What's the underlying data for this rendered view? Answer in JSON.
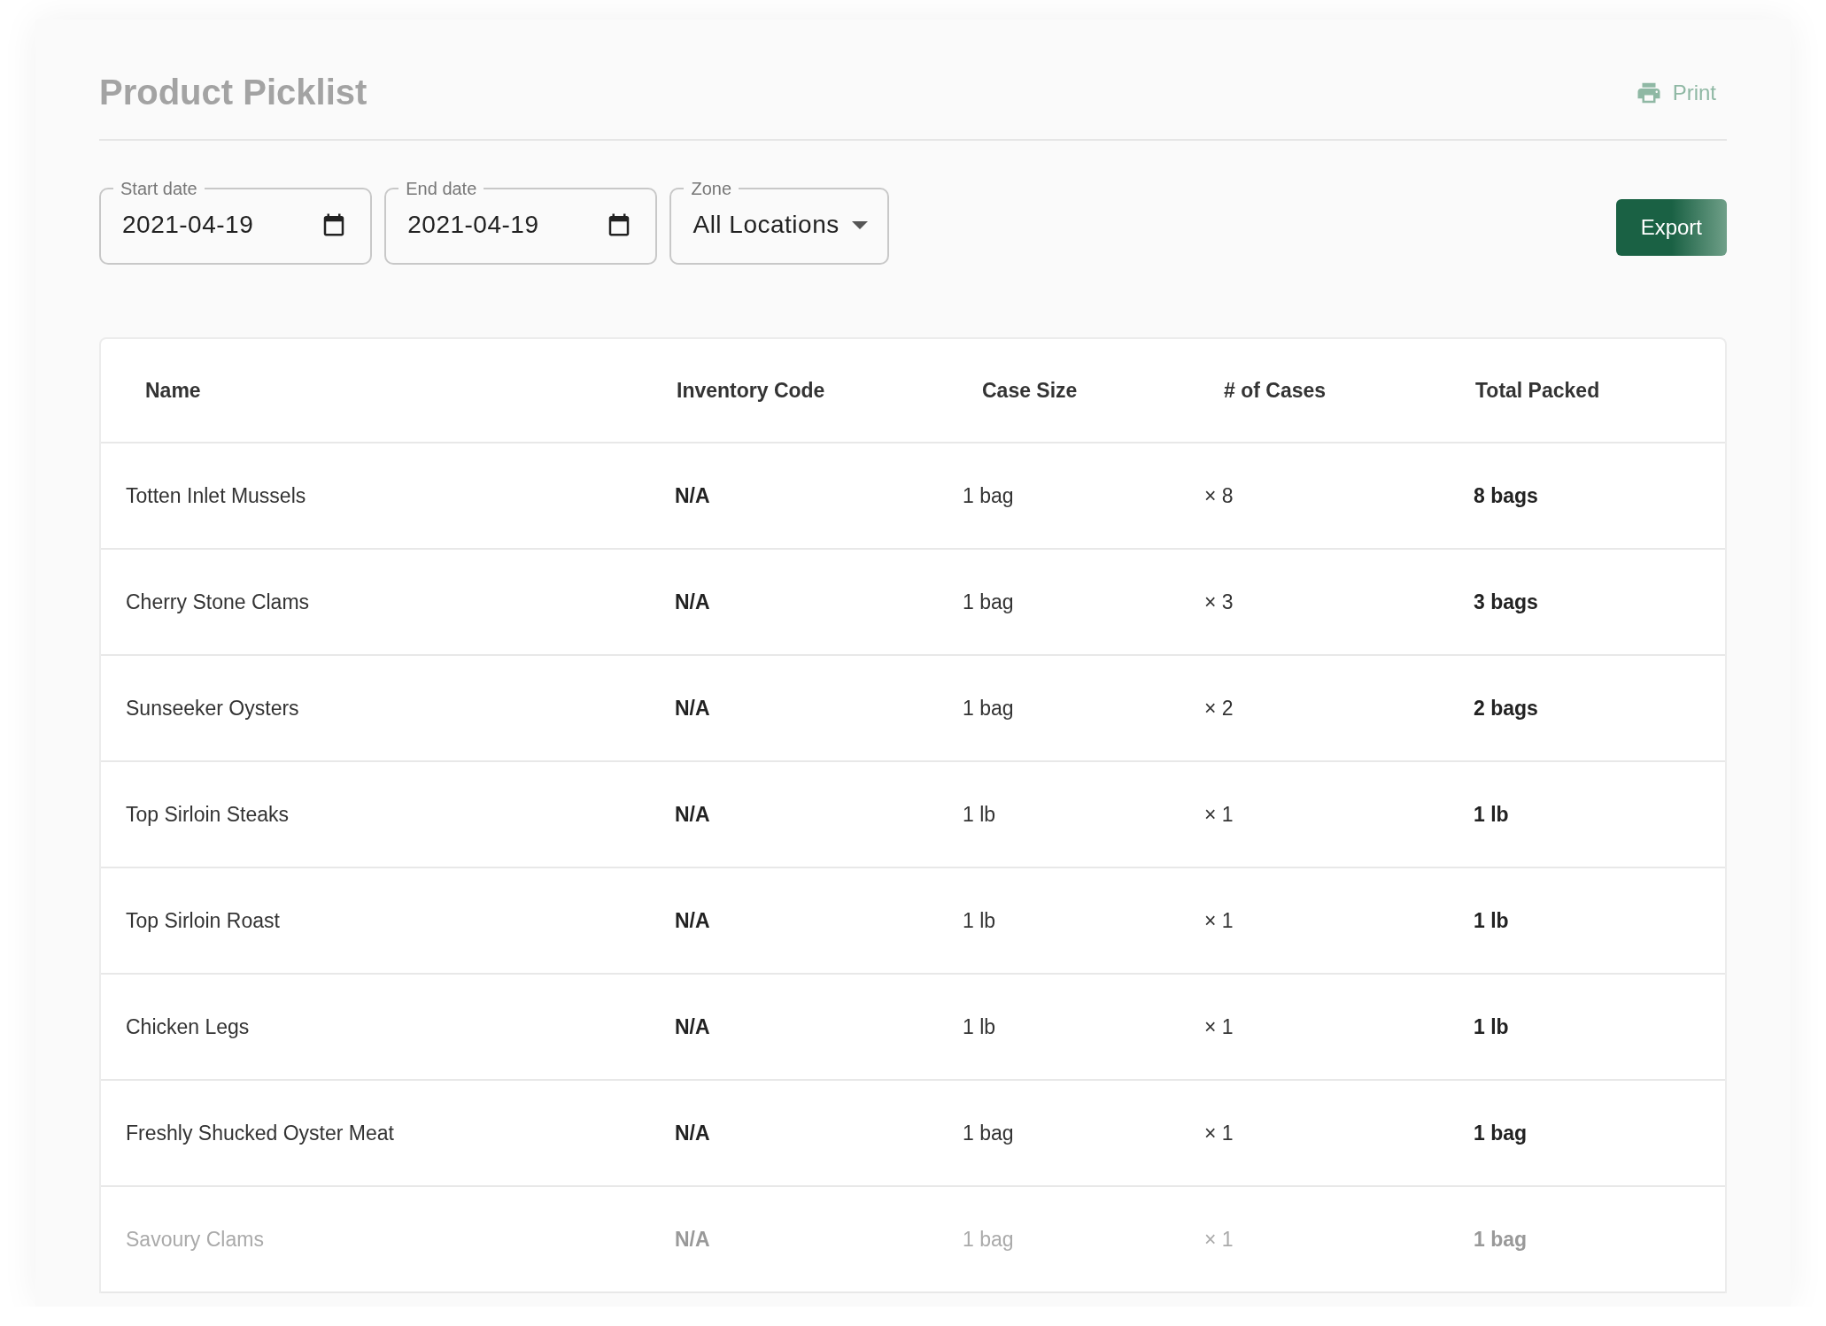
{
  "page": {
    "title": "Product Picklist",
    "print_label": "Print"
  },
  "filters": [
    {
      "kind": "date",
      "label": "Start date",
      "value": "2021-04-19"
    },
    {
      "kind": "date",
      "label": "End date",
      "value": "2021-04-19"
    },
    {
      "kind": "select",
      "label": "Zone",
      "value": "All Locations"
    }
  ],
  "export_button": "Export",
  "table": {
    "columns": [
      "Name",
      "Inventory Code",
      "Case Size",
      "# of Cases",
      "Total Packed"
    ],
    "rows": [
      {
        "name": "Totten Inlet Mussels",
        "code": "N/A",
        "case_size": "1 bag",
        "cases": "× 8",
        "total": "8 bags",
        "faded": false
      },
      {
        "name": "Cherry Stone Clams",
        "code": "N/A",
        "case_size": "1 bag",
        "cases": "× 3",
        "total": "3 bags",
        "faded": false
      },
      {
        "name": "Sunseeker Oysters",
        "code": "N/A",
        "case_size": "1 bag",
        "cases": "× 2",
        "total": "2 bags",
        "faded": false
      },
      {
        "name": "Top Sirloin Steaks",
        "code": "N/A",
        "case_size": "1 lb",
        "cases": "× 1",
        "total": "1 lb",
        "faded": false
      },
      {
        "name": "Top Sirloin Roast",
        "code": "N/A",
        "case_size": "1 lb",
        "cases": "× 1",
        "total": "1 lb",
        "faded": false
      },
      {
        "name": "Chicken Legs",
        "code": "N/A",
        "case_size": "1 lb",
        "cases": "× 1",
        "total": "1 lb",
        "faded": false
      },
      {
        "name": "Freshly Shucked Oyster Meat",
        "code": "N/A",
        "case_size": "1 bag",
        "cases": "× 1",
        "total": "1 bag",
        "faded": false
      },
      {
        "name": "Savoury Clams",
        "code": "N/A",
        "case_size": "1 bag",
        "cases": "× 1",
        "total": "1 bag",
        "faded": true
      }
    ]
  }
}
